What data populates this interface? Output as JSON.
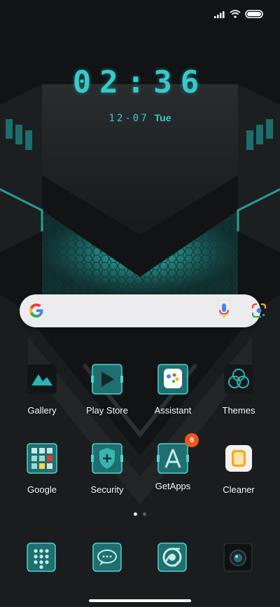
{
  "status": {
    "signal_icon": "signal-icon",
    "wifi_icon": "wifi-icon",
    "battery_icon": "battery-icon"
  },
  "clock": {
    "time": "02:36",
    "date": "12-07",
    "day": "Tue"
  },
  "search": {
    "google_icon": "google-logo-icon",
    "mic_icon": "microphone-icon",
    "lens_icon": "google-lens-icon"
  },
  "apps": [
    {
      "label": "Gallery"
    },
    {
      "label": "Play Store"
    },
    {
      "label": "Assistant"
    },
    {
      "label": "Themes"
    },
    {
      "label": "Google"
    },
    {
      "label": "Security"
    },
    {
      "label": "GetApps",
      "badge": "6"
    },
    {
      "label": "Cleaner"
    }
  ],
  "pages": {
    "count": 2,
    "current": 1
  },
  "dock": [
    {
      "icon": "phone-dialpad-icon"
    },
    {
      "icon": "messages-icon"
    },
    {
      "icon": "chrome-icon"
    },
    {
      "icon": "camera-icon"
    }
  ],
  "colors": {
    "accent": "#38c9cc",
    "badge": "#f2541b",
    "icon_teal": "#1f6f70"
  }
}
